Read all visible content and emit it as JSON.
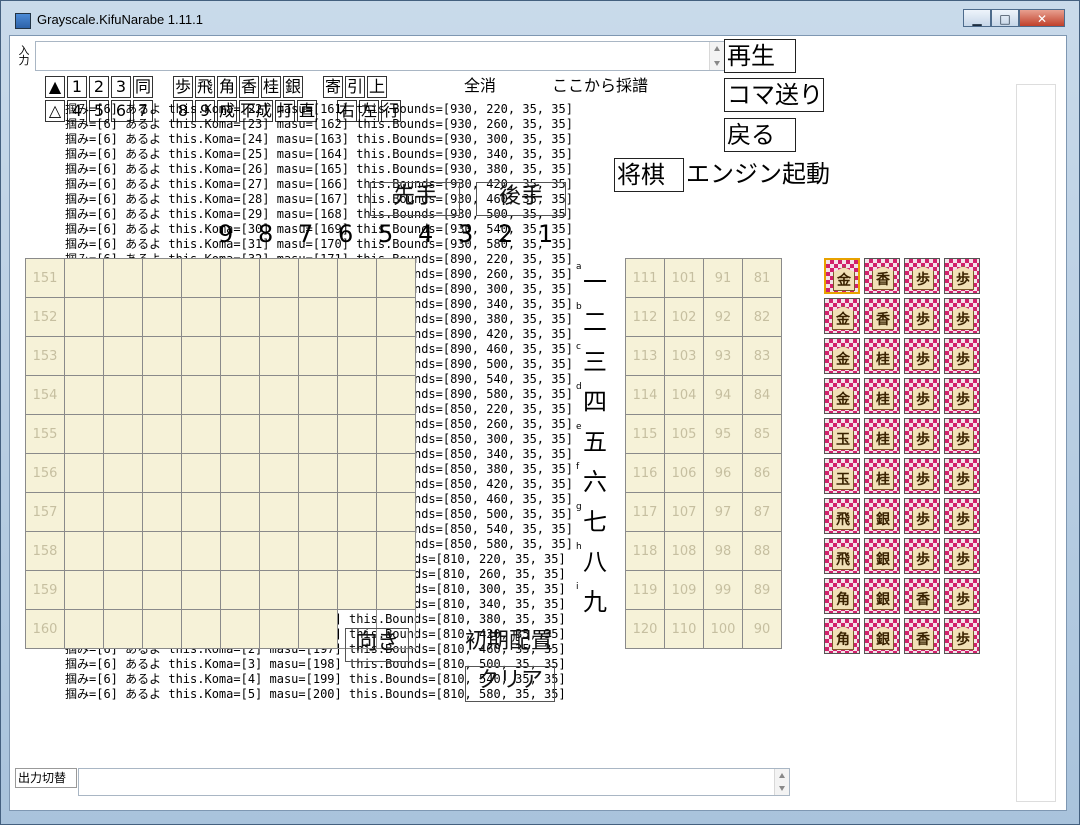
{
  "window": {
    "title": "Grayscale.KifuNarabe 1.11.1",
    "minimize": "▁",
    "maximize": "□",
    "close": "✕"
  },
  "input": {
    "label": "入力",
    "value": ""
  },
  "buttons": {
    "play": "再生",
    "step": "コマ送り",
    "back": "戻る",
    "engine_box": "将棋",
    "engine_rest": "エンジン起動",
    "sente": "先手",
    "gote": "後手",
    "clear": "全消",
    "record_from_here": "ここから採譜",
    "face_forward": "向き",
    "initial_setup": "初期配置",
    "clear_board": "クリア",
    "output_toggle": "出力切替"
  },
  "toolbar_row1": [
    "▲",
    "1",
    "2",
    "3",
    "同",
    "歩",
    "飛",
    "角",
    "香",
    "桂",
    "銀",
    "寄",
    "引",
    "上"
  ],
  "toolbar_row2": [
    "△",
    "4",
    "5",
    "6",
    "7",
    "8",
    "9",
    "成",
    "不成",
    "打",
    "直",
    "右",
    "左",
    "行"
  ],
  "log_lines": [
    "掴み=[6] あるよ this.Koma=[22] masu=[161] this.Bounds=[930, 220, 35, 35]",
    "掴み=[6] あるよ this.Koma=[23] masu=[162] this.Bounds=[930, 260, 35, 35]",
    "掴み=[6] あるよ this.Koma=[24] masu=[163] this.Bounds=[930, 300, 35, 35]",
    "掴み=[6] あるよ this.Koma=[25] masu=[164] this.Bounds=[930, 340, 35, 35]",
    "掴み=[6] あるよ this.Koma=[26] masu=[165] this.Bounds=[930, 380, 35, 35]",
    "掴み=[6] あるよ this.Koma=[27] masu=[166] this.Bounds=[930, 420, 35, 35]",
    "掴み=[6] あるよ this.Koma=[28] masu=[167] this.Bounds=[930, 460, 35, 35]",
    "掴み=[6] あるよ this.Koma=[29] masu=[168] this.Bounds=[930, 500, 35, 35]",
    "掴み=[6] あるよ this.Koma=[30] masu=[169] this.Bounds=[930, 540, 35, 35]",
    "掴み=[6] あるよ this.Koma=[31] masu=[170] this.Bounds=[930, 580, 35, 35]",
    "掴み=[6] あるよ this.Koma=[32] masu=[171] this.Bounds=[890, 220, 35, 35]",
    "掴み=[6] あるよ this.Koma=[33] masu=[172] this.Bounds=[890, 260, 35, 35]",
    "掴み=[6] あるよ this.Koma=[34] masu=[173] this.Bounds=[890, 300, 35, 35]",
    "掴み=[6] あるよ this.Koma=[35] masu=[174] this.Bounds=[890, 340, 35, 35]",
    "掴み=[6] あるよ this.Koma=[36] masu=[175] this.Bounds=[890, 380, 35, 35]",
    "掴み=[6] あるよ this.Koma=[37] masu=[176] this.Bounds=[890, 420, 35, 35]",
    "掴み=[6] あるよ this.Koma=[38] masu=[177] this.Bounds=[890, 460, 35, 35]",
    "掴み=[6] あるよ this.Koma=[39] masu=[178] this.Bounds=[890, 500, 35, 35]",
    "掴み=[6] あるよ this.Koma=[10] masu=[179] this.Bounds=[890, 540, 35, 35]",
    "掴み=[6] あるよ this.Koma=[19] masu=[180] this.Bounds=[890, 580, 35, 35]",
    "掴み=[6] あるよ this.Koma=[20] masu=[181] this.Bounds=[850, 220, 35, 35]",
    "掴み=[6] あるよ this.Koma=[21] masu=[182] this.Bounds=[850, 260, 35, 35]",
    "掴み=[6] あるよ this.Koma=[14] masu=[183] this.Bounds=[850, 300, 35, 35]",
    "掴み=[6] あるよ this.Koma=[15] masu=[184] this.Bounds=[850, 340, 35, 35]",
    "掴み=[6] あるよ this.Koma=[16] masu=[185] this.Bounds=[850, 380, 35, 35]",
    "掴み=[6] あるよ this.Koma=[17] masu=[186] this.Bounds=[850, 420, 35, 35]",
    "掴み=[6] あるよ this.Koma=[10] masu=[187] this.Bounds=[850, 460, 35, 35]",
    "掴み=[6] あるよ this.Koma=[11] masu=[188] this.Bounds=[850, 500, 35, 35]",
    "掴み=[6] あるよ this.Koma=[12] masu=[189] this.Bounds=[850, 540, 35, 35]",
    "掴み=[6] あるよ this.Koma=[13] masu=[190] this.Bounds=[850, 580, 35, 35]",
    "掴み=[6] あるよ this.Koma=[6] masu=[191] this.Bounds=[810, 220, 35, 35]",
    "掴み=[6] あるよ this.Koma=[7] masu=[192] this.Bounds=[810, 260, 35, 35]",
    "掴み=[6] あるよ this.Koma=[8] masu=[193] this.Bounds=[810, 300, 35, 35]",
    "掴み=[6] あるよ this.Koma=[9] masu=[194] this.Bounds=[810, 340, 35, 35]",
    "掴み=[6] あるよ this.Koma=[0] masu=[195] this.Bounds=[810, 380, 35, 35]",
    "掴み=[6] あるよ this.Koma=[1] masu=[196] this.Bounds=[810, 420, 35, 35]",
    "掴み=[6] あるよ this.Koma=[2] masu=[197] this.Bounds=[810, 460, 35, 35]",
    "掴み=[6] あるよ this.Koma=[3] masu=[198] this.Bounds=[810, 500, 35, 35]",
    "掴み=[6] あるよ this.Koma=[4] masu=[199] this.Bounds=[810, 540, 35, 35]",
    "掴み=[6] あるよ this.Koma=[5] masu=[200] this.Bounds=[810, 580, 35, 35]"
  ],
  "board": {
    "col_numbers": [
      "9",
      "8",
      "7",
      "6",
      "5",
      "4",
      "3",
      "2",
      "1"
    ],
    "row_letters": [
      "a",
      "b",
      "c",
      "d",
      "e",
      "f",
      "g",
      "h",
      "i"
    ],
    "row_kanji": [
      "一",
      "二",
      "三",
      "四",
      "五",
      "六",
      "七",
      "八",
      "九"
    ],
    "left_stand": [
      "151",
      "152",
      "153",
      "154",
      "155",
      "156",
      "157",
      "158",
      "159",
      "160"
    ]
  },
  "stand_right_rows": [
    [
      "111",
      "101",
      "91",
      "81"
    ],
    [
      "112",
      "102",
      "92",
      "82"
    ],
    [
      "113",
      "103",
      "93",
      "83"
    ],
    [
      "114",
      "104",
      "94",
      "84"
    ],
    [
      "115",
      "105",
      "95",
      "85"
    ],
    [
      "116",
      "106",
      "96",
      "86"
    ],
    [
      "117",
      "107",
      "97",
      "87"
    ],
    [
      "118",
      "108",
      "98",
      "88"
    ],
    [
      "119",
      "109",
      "99",
      "89"
    ],
    [
      "120",
      "110",
      "100",
      "90"
    ]
  ],
  "piece_box": [
    [
      "金",
      "香",
      "歩",
      "歩"
    ],
    [
      "金",
      "香",
      "歩",
      "歩"
    ],
    [
      "金",
      "桂",
      "歩",
      "歩"
    ],
    [
      "金",
      "桂",
      "歩",
      "歩"
    ],
    [
      "玉",
      "桂",
      "歩",
      "歩"
    ],
    [
      "玉",
      "桂",
      "歩",
      "歩"
    ],
    [
      "飛",
      "銀",
      "歩",
      "歩"
    ],
    [
      "飛",
      "銀",
      "歩",
      "歩"
    ],
    [
      "角",
      "銀",
      "香",
      "歩"
    ],
    [
      "角",
      "銀",
      "香",
      "歩"
    ]
  ],
  "output": {
    "value": ""
  }
}
